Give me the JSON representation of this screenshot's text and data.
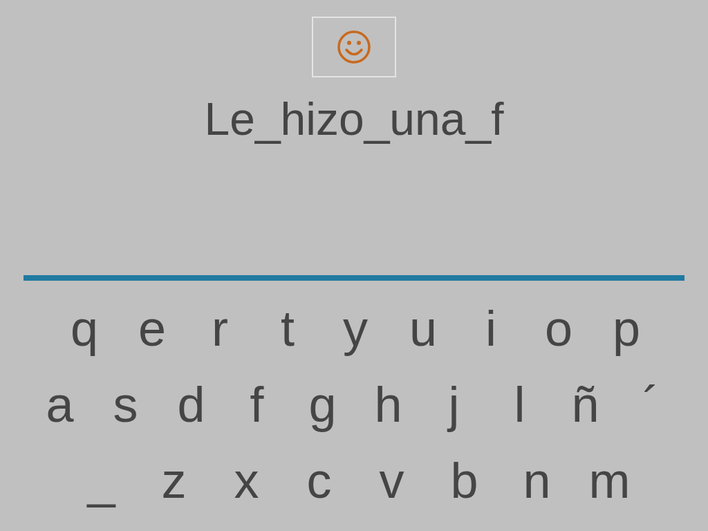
{
  "phrase": "Le_hizo_una_f",
  "keyboard": {
    "rows": [
      [
        "q",
        "e",
        "r",
        "t",
        "y",
        "u",
        "i",
        "o",
        "p"
      ],
      [
        "a",
        "s",
        "d",
        "f",
        "g",
        "h",
        "j",
        "l",
        "ñ",
        "´"
      ],
      [
        "_",
        "z",
        "x",
        "c",
        "v",
        "b",
        "n",
        "m"
      ]
    ]
  }
}
